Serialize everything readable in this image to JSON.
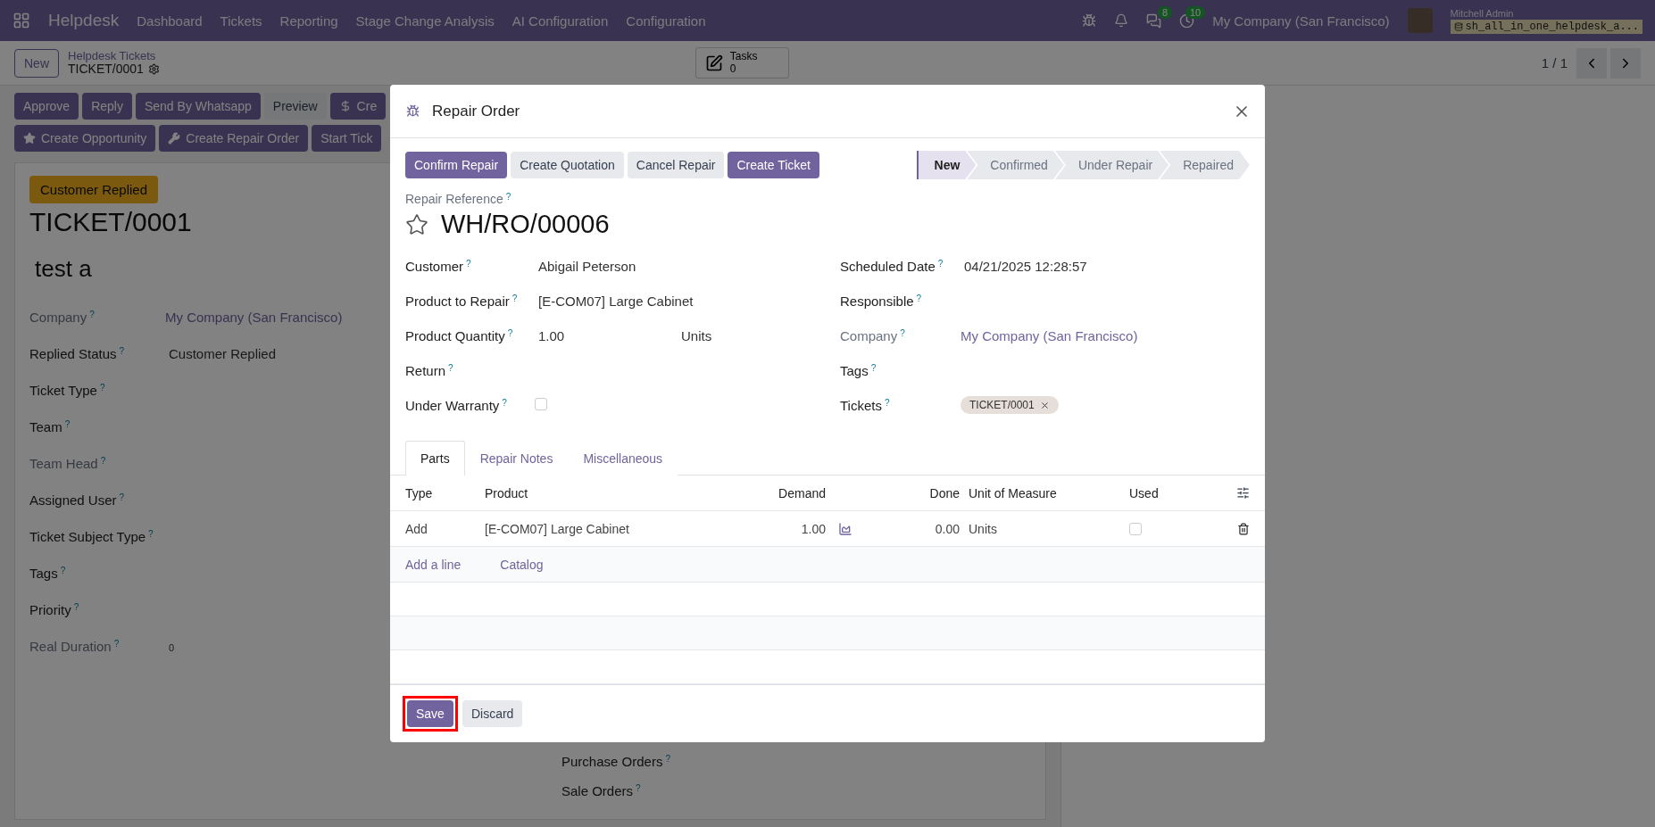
{
  "navbar": {
    "app_name": "Helpdesk",
    "menu": [
      "Dashboard",
      "Tickets",
      "Reporting",
      "Stage Change Analysis",
      "AI Configuration",
      "Configuration"
    ],
    "chat_count": "8",
    "activity_count": "10",
    "company": "My Company (San Francisco)",
    "user_name": "Mitchell Admin",
    "database": "sh_all_in_one_helpdesk_a..."
  },
  "control_panel": {
    "new_button": "New",
    "breadcrumb_parent": "Helpdesk Tickets",
    "record_name": "TICKET/0001",
    "tasks_label": "Tasks",
    "tasks_count": "0",
    "pager": "1 / 1"
  },
  "action_buttons": [
    [
      {
        "label": "Approve",
        "kind": "primary"
      },
      {
        "label": "Reply",
        "kind": "primary"
      },
      {
        "label": "Send By Whatsapp",
        "kind": "primary"
      },
      {
        "label": "Preview",
        "kind": "secondary"
      },
      {
        "label": "Cre",
        "kind": "primary"
      }
    ],
    [
      {
        "label": "Create Opportunity",
        "kind": "primary"
      },
      {
        "label": "Create Repair Order",
        "kind": "primary"
      },
      {
        "label": "Start Tick",
        "kind": "primary"
      }
    ]
  ],
  "sheet": {
    "status_badge": "Customer Replied",
    "title": "TICKET/0001",
    "subtitle": "test a",
    "fields": [
      {
        "label": "Company",
        "help": "?",
        "value": "My Company (San Francisco)",
        "kind": "link",
        "readonly": true
      },
      {
        "label": "Replied Status",
        "help": "?",
        "value": "Customer Replied",
        "kind": "text",
        "readonly": false
      },
      {
        "label": "Ticket Type",
        "help": "?",
        "readonly": false
      },
      {
        "label": "Team",
        "help": "?",
        "readonly": false
      },
      {
        "label": "Team Head",
        "help": "?",
        "readonly": true
      },
      {
        "label": "Assigned User",
        "help": "?",
        "readonly": false
      },
      {
        "label": "Ticket Subject Type",
        "help": "?",
        "readonly": false
      },
      {
        "label": "Tags",
        "help": "?",
        "readonly": false
      },
      {
        "label": "Priority",
        "help": "?",
        "readonly": false
      },
      {
        "label": "Real Duration",
        "help": "?",
        "value": "0",
        "kind": "small",
        "readonly": true
      }
    ],
    "lower_fields": [
      {
        "label": "Purchase Orders",
        "help": "?"
      },
      {
        "label": "Sale Orders",
        "help": "?"
      }
    ]
  },
  "modal": {
    "title": "Repair Order",
    "buttons": [
      {
        "label": "Confirm Repair",
        "kind": "primary"
      },
      {
        "label": "Create Quotation",
        "kind": "secondary"
      },
      {
        "label": "Cancel Repair",
        "kind": "secondary"
      },
      {
        "label": "Create Ticket",
        "kind": "primary"
      }
    ],
    "stages": [
      {
        "label": "New",
        "selected": true
      },
      {
        "label": "Confirmed",
        "selected": false
      },
      {
        "label": "Under Repair",
        "selected": false
      },
      {
        "label": "Repaired",
        "selected": false
      }
    ],
    "reference_label": "Repair Reference",
    "reference_help": "?",
    "reference": "WH/RO/00006",
    "starred": false,
    "left_fields": [
      {
        "label": "Customer",
        "help": "?",
        "kind": "text",
        "value": "Abigail Peterson"
      },
      {
        "label": "Product to Repair",
        "help": "?",
        "kind": "text",
        "value": "[E-COM07] Large Cabinet"
      },
      {
        "label": "Product Quantity",
        "help": "?",
        "kind": "quantity",
        "value": "1.00",
        "unit": "Units"
      },
      {
        "label": "Return",
        "help": "?",
        "kind": "text"
      },
      {
        "label": "Under Warranty",
        "help": "?",
        "kind": "checkbox",
        "checked": false
      }
    ],
    "right_fields": [
      {
        "label": "Scheduled Date",
        "help": "?",
        "kind": "text",
        "value": "04/21/2025 12:28:57"
      },
      {
        "label": "Responsible",
        "help": "?",
        "kind": "text"
      },
      {
        "label": "Company",
        "help": "?",
        "kind": "link",
        "value": "My Company (San Francisco)",
        "readonly": true
      },
      {
        "label": "Tags",
        "help": "?",
        "kind": "text"
      },
      {
        "label": "Tickets",
        "help": "?",
        "kind": "tags",
        "tags": [
          "TICKET/0001"
        ]
      }
    ],
    "tabs": [
      {
        "label": "Parts",
        "selected": true
      },
      {
        "label": "Repair Notes",
        "selected": false
      },
      {
        "label": "Miscellaneous",
        "selected": false
      }
    ],
    "table": {
      "columns": [
        "Type",
        "Product",
        "Demand",
        "Done",
        "Unit of Measure",
        "Used"
      ],
      "rows": [
        {
          "type": "Add",
          "product": "[E-COM07] Large Cabinet",
          "demand": "1.00",
          "done": "0.00",
          "uom": "Units",
          "used": false
        }
      ],
      "add_line": "Add a line",
      "catalog": "Catalog"
    },
    "footer": [
      {
        "label": "Save",
        "kind": "primary",
        "highlighted": true
      },
      {
        "label": "Discard",
        "kind": "secondary",
        "highlighted": false
      }
    ]
  }
}
